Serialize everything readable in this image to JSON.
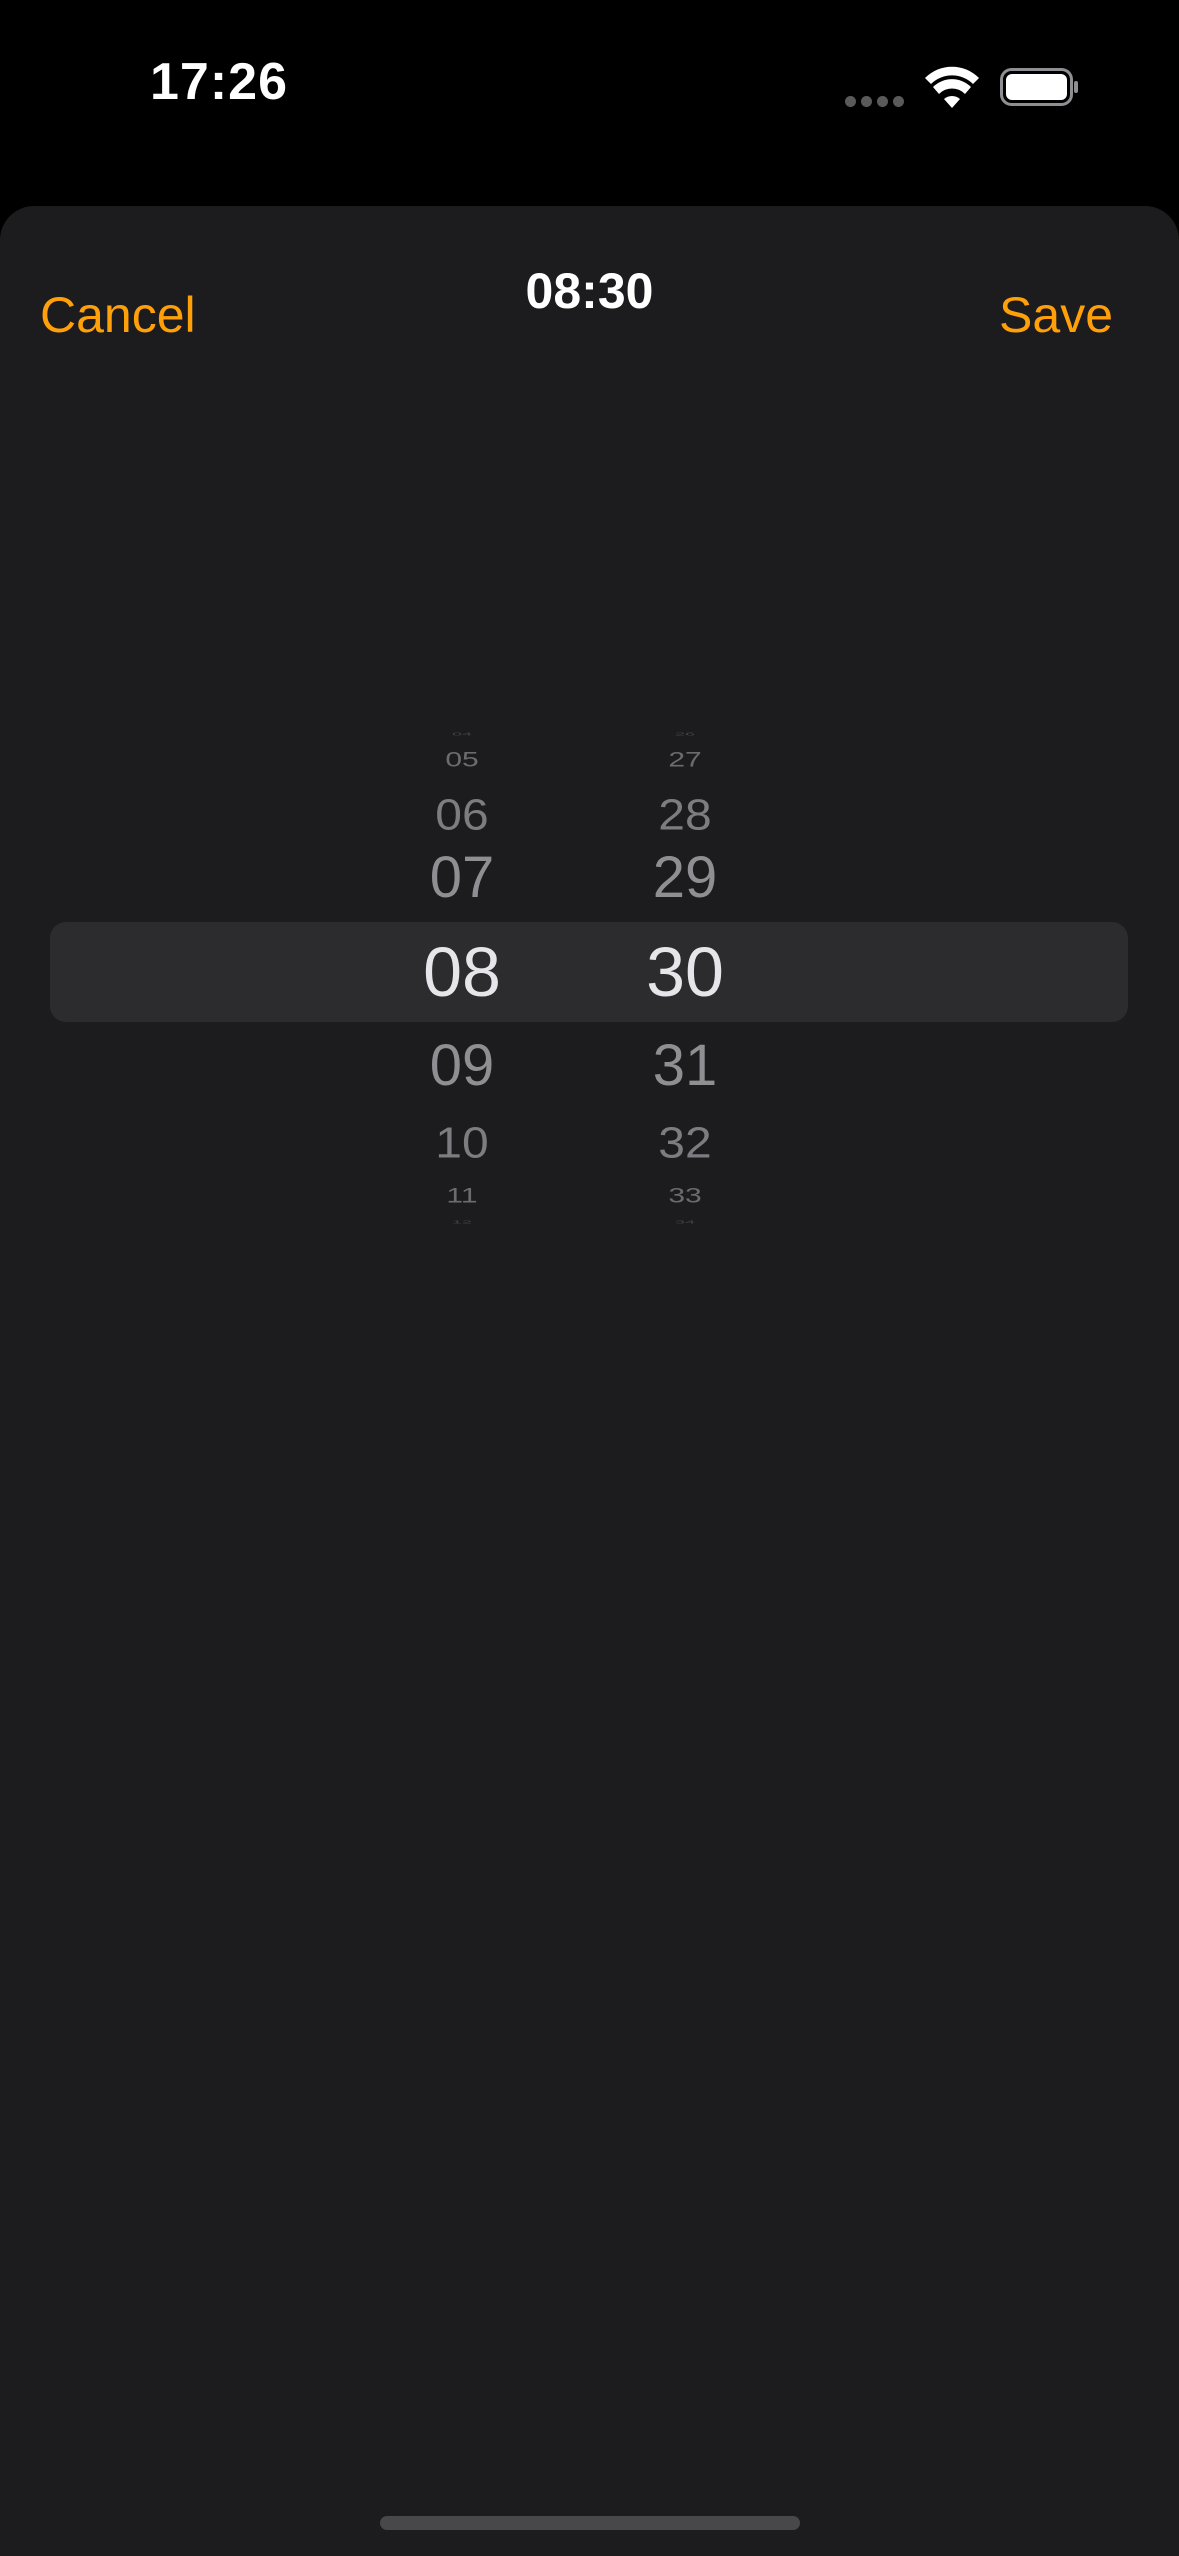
{
  "status_bar": {
    "time": "17:26"
  },
  "sheet": {
    "title": "08:30",
    "cancel_label": "Cancel",
    "save_label": "Save"
  },
  "picker": {
    "hours": [
      "04",
      "05",
      "06",
      "07",
      "08",
      "09",
      "10",
      "11",
      "12"
    ],
    "minutes": [
      "26",
      "27",
      "28",
      "29",
      "30",
      "31",
      "32",
      "33",
      "34"
    ],
    "selected_hour": "08",
    "selected_minute": "30"
  },
  "colors": {
    "accent": "#ff9f0a",
    "sheet_background": "#1c1c1e",
    "selection_band": "#2c2c2e"
  }
}
